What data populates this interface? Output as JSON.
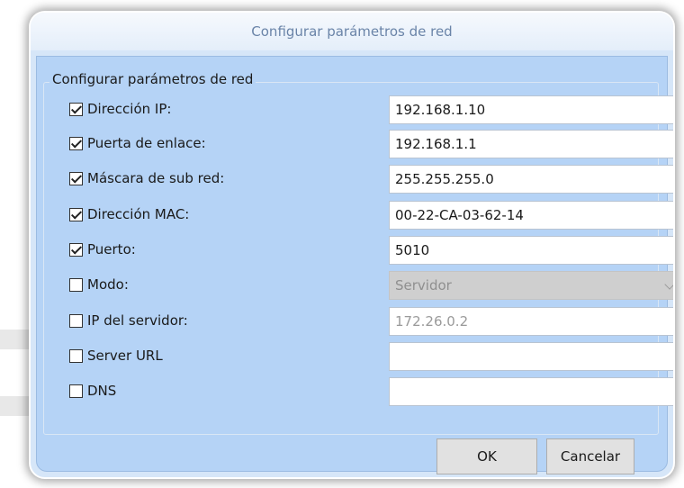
{
  "dialog": {
    "title": "Configurar parámetros de red",
    "group_label": "Configurar parámetros de red"
  },
  "fields": [
    {
      "label": "Dirección IP:",
      "checked": true,
      "value": "192.168.1.10",
      "type": "text"
    },
    {
      "label": "Puerta de enlace:",
      "checked": true,
      "value": "192.168.1.1",
      "type": "text"
    },
    {
      "label": "Máscara de sub red:",
      "checked": true,
      "value": "255.255.255.0",
      "type": "text"
    },
    {
      "label": "Dirección MAC:",
      "checked": true,
      "value": "00-22-CA-03-62-14",
      "type": "text"
    },
    {
      "label": "Puerto:",
      "checked": true,
      "value": "5010",
      "type": "text"
    },
    {
      "label": "Modo:",
      "checked": false,
      "value": "Servidor",
      "type": "select"
    },
    {
      "label": "IP del servidor:",
      "checked": false,
      "value": "172.26.0.2",
      "type": "text-disabled"
    },
    {
      "label": "Server URL",
      "checked": false,
      "value": "",
      "type": "text"
    },
    {
      "label": "DNS",
      "checked": false,
      "value": "",
      "type": "text"
    }
  ],
  "buttons": {
    "ok": "OK",
    "cancel": "Cancelar"
  },
  "colors": {
    "client_bg": "#b5d3f6",
    "title_text": "#6a84a8",
    "disabled_bg": "#cfcfcf"
  },
  "icons": {
    "checkbox_checked": "check-mark-icon",
    "select_arrow": "chevron-down-icon"
  }
}
